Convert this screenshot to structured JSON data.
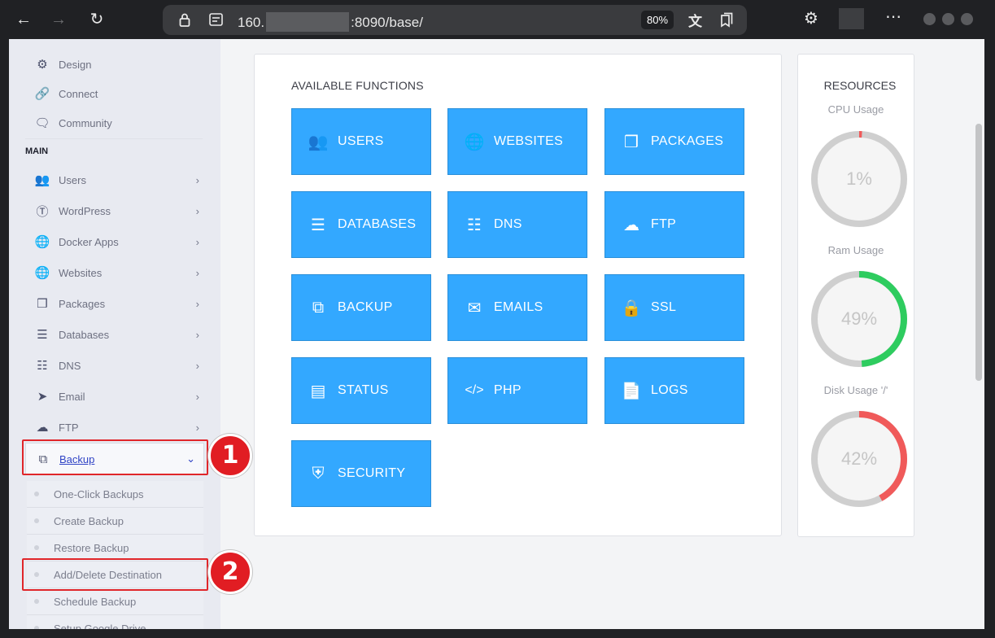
{
  "browser": {
    "url_prefix": "160.",
    "url_suffix": ":8090/base/",
    "zoom": "80%"
  },
  "sidebar": {
    "top_items": [
      {
        "label": "Design",
        "icon": "gear-icon"
      },
      {
        "label": "Connect",
        "icon": "link-icon"
      },
      {
        "label": "Community",
        "icon": "chat-icon"
      }
    ],
    "section_title": "MAIN",
    "items": [
      {
        "label": "Users",
        "icon": "users-icon"
      },
      {
        "label": "WordPress",
        "icon": "wordpress-icon"
      },
      {
        "label": "Docker Apps",
        "icon": "globe-icon"
      },
      {
        "label": "Websites",
        "icon": "globe-icon"
      },
      {
        "label": "Packages",
        "icon": "cubes-icon"
      },
      {
        "label": "Databases",
        "icon": "database-icon"
      },
      {
        "label": "DNS",
        "icon": "sitemap-icon"
      },
      {
        "label": "Email",
        "icon": "paper-plane-icon"
      },
      {
        "label": "FTP",
        "icon": "cloud-upload-icon"
      }
    ],
    "backup": {
      "label": "Backup",
      "icon": "copy-icon"
    },
    "backup_sub": [
      {
        "label": "One-Click Backups"
      },
      {
        "label": "Create Backup"
      },
      {
        "label": "Restore Backup"
      },
      {
        "label": "Add/Delete Destination"
      },
      {
        "label": "Schedule Backup"
      },
      {
        "label": "Setup Google Drive"
      }
    ]
  },
  "callouts": [
    "1",
    "2"
  ],
  "main": {
    "title": "AVAILABLE FUNCTIONS",
    "tiles": [
      {
        "label": "USERS",
        "icon": "users-icon"
      },
      {
        "label": "WEBSITES",
        "icon": "globe-icon"
      },
      {
        "label": "PACKAGES",
        "icon": "cubes-icon"
      },
      {
        "label": "DATABASES",
        "icon": "database-icon"
      },
      {
        "label": "DNS",
        "icon": "sitemap-icon"
      },
      {
        "label": "FTP",
        "icon": "cloud-upload-icon"
      },
      {
        "label": "BACKUP",
        "icon": "copy-icon"
      },
      {
        "label": "EMAILS",
        "icon": "envelope-icon"
      },
      {
        "label": "SSL",
        "icon": "lock-icon"
      },
      {
        "label": "STATUS",
        "icon": "server-icon"
      },
      {
        "label": "PHP",
        "icon": "code-icon"
      },
      {
        "label": "LOGS",
        "icon": "file-icon"
      },
      {
        "label": "SECURITY",
        "icon": "shield-icon"
      }
    ]
  },
  "resources": {
    "title": "RESOURCES",
    "gauges": [
      {
        "label": "CPU Usage",
        "value": 1,
        "display": "1%",
        "color": "#f05a5a"
      },
      {
        "label": "Ram Usage",
        "value": 49,
        "display": "49%",
        "color": "#2ecc5f"
      },
      {
        "label": "Disk Usage '/'",
        "value": 42,
        "display": "42%",
        "color": "#f05a5a"
      }
    ]
  }
}
